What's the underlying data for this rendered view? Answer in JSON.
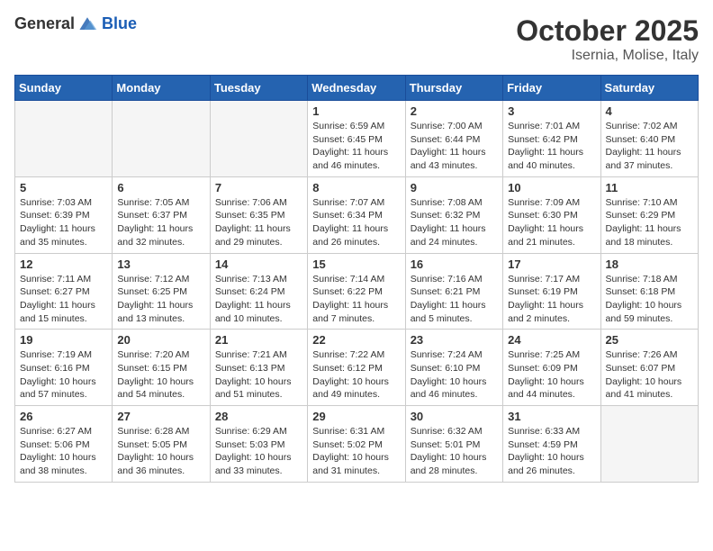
{
  "logo": {
    "general": "General",
    "blue": "Blue"
  },
  "title": "October 2025",
  "subtitle": "Isernia, Molise, Italy",
  "days_of_week": [
    "Sunday",
    "Monday",
    "Tuesday",
    "Wednesday",
    "Thursday",
    "Friday",
    "Saturday"
  ],
  "weeks": [
    [
      {
        "day": "",
        "info": ""
      },
      {
        "day": "",
        "info": ""
      },
      {
        "day": "",
        "info": ""
      },
      {
        "day": "1",
        "info": "Sunrise: 6:59 AM\nSunset: 6:45 PM\nDaylight: 11 hours and 46 minutes."
      },
      {
        "day": "2",
        "info": "Sunrise: 7:00 AM\nSunset: 6:44 PM\nDaylight: 11 hours and 43 minutes."
      },
      {
        "day": "3",
        "info": "Sunrise: 7:01 AM\nSunset: 6:42 PM\nDaylight: 11 hours and 40 minutes."
      },
      {
        "day": "4",
        "info": "Sunrise: 7:02 AM\nSunset: 6:40 PM\nDaylight: 11 hours and 37 minutes."
      }
    ],
    [
      {
        "day": "5",
        "info": "Sunrise: 7:03 AM\nSunset: 6:39 PM\nDaylight: 11 hours and 35 minutes."
      },
      {
        "day": "6",
        "info": "Sunrise: 7:05 AM\nSunset: 6:37 PM\nDaylight: 11 hours and 32 minutes."
      },
      {
        "day": "7",
        "info": "Sunrise: 7:06 AM\nSunset: 6:35 PM\nDaylight: 11 hours and 29 minutes."
      },
      {
        "day": "8",
        "info": "Sunrise: 7:07 AM\nSunset: 6:34 PM\nDaylight: 11 hours and 26 minutes."
      },
      {
        "day": "9",
        "info": "Sunrise: 7:08 AM\nSunset: 6:32 PM\nDaylight: 11 hours and 24 minutes."
      },
      {
        "day": "10",
        "info": "Sunrise: 7:09 AM\nSunset: 6:30 PM\nDaylight: 11 hours and 21 minutes."
      },
      {
        "day": "11",
        "info": "Sunrise: 7:10 AM\nSunset: 6:29 PM\nDaylight: 11 hours and 18 minutes."
      }
    ],
    [
      {
        "day": "12",
        "info": "Sunrise: 7:11 AM\nSunset: 6:27 PM\nDaylight: 11 hours and 15 minutes."
      },
      {
        "day": "13",
        "info": "Sunrise: 7:12 AM\nSunset: 6:25 PM\nDaylight: 11 hours and 13 minutes."
      },
      {
        "day": "14",
        "info": "Sunrise: 7:13 AM\nSunset: 6:24 PM\nDaylight: 11 hours and 10 minutes."
      },
      {
        "day": "15",
        "info": "Sunrise: 7:14 AM\nSunset: 6:22 PM\nDaylight: 11 hours and 7 minutes."
      },
      {
        "day": "16",
        "info": "Sunrise: 7:16 AM\nSunset: 6:21 PM\nDaylight: 11 hours and 5 minutes."
      },
      {
        "day": "17",
        "info": "Sunrise: 7:17 AM\nSunset: 6:19 PM\nDaylight: 11 hours and 2 minutes."
      },
      {
        "day": "18",
        "info": "Sunrise: 7:18 AM\nSunset: 6:18 PM\nDaylight: 10 hours and 59 minutes."
      }
    ],
    [
      {
        "day": "19",
        "info": "Sunrise: 7:19 AM\nSunset: 6:16 PM\nDaylight: 10 hours and 57 minutes."
      },
      {
        "day": "20",
        "info": "Sunrise: 7:20 AM\nSunset: 6:15 PM\nDaylight: 10 hours and 54 minutes."
      },
      {
        "day": "21",
        "info": "Sunrise: 7:21 AM\nSunset: 6:13 PM\nDaylight: 10 hours and 51 minutes."
      },
      {
        "day": "22",
        "info": "Sunrise: 7:22 AM\nSunset: 6:12 PM\nDaylight: 10 hours and 49 minutes."
      },
      {
        "day": "23",
        "info": "Sunrise: 7:24 AM\nSunset: 6:10 PM\nDaylight: 10 hours and 46 minutes."
      },
      {
        "day": "24",
        "info": "Sunrise: 7:25 AM\nSunset: 6:09 PM\nDaylight: 10 hours and 44 minutes."
      },
      {
        "day": "25",
        "info": "Sunrise: 7:26 AM\nSunset: 6:07 PM\nDaylight: 10 hours and 41 minutes."
      }
    ],
    [
      {
        "day": "26",
        "info": "Sunrise: 6:27 AM\nSunset: 5:06 PM\nDaylight: 10 hours and 38 minutes."
      },
      {
        "day": "27",
        "info": "Sunrise: 6:28 AM\nSunset: 5:05 PM\nDaylight: 10 hours and 36 minutes."
      },
      {
        "day": "28",
        "info": "Sunrise: 6:29 AM\nSunset: 5:03 PM\nDaylight: 10 hours and 33 minutes."
      },
      {
        "day": "29",
        "info": "Sunrise: 6:31 AM\nSunset: 5:02 PM\nDaylight: 10 hours and 31 minutes."
      },
      {
        "day": "30",
        "info": "Sunrise: 6:32 AM\nSunset: 5:01 PM\nDaylight: 10 hours and 28 minutes."
      },
      {
        "day": "31",
        "info": "Sunrise: 6:33 AM\nSunset: 4:59 PM\nDaylight: 10 hours and 26 minutes."
      },
      {
        "day": "",
        "info": ""
      }
    ]
  ]
}
